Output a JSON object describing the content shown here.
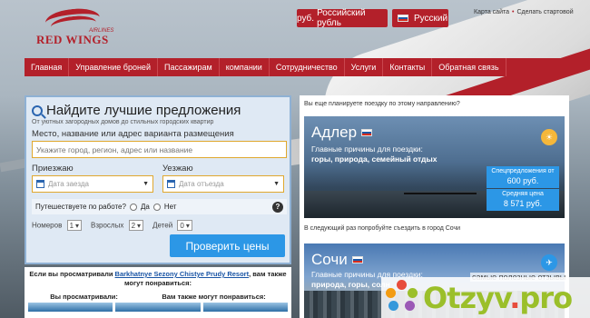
{
  "header": {
    "logo_text": "RED WINGS",
    "logo_sub": "AIRLINES",
    "currency_symbol": "руб.",
    "currency_label": "Российский рубль",
    "language_label": "Русский",
    "links": [
      "Карта сайта",
      "Сделать стартовой"
    ]
  },
  "nav": {
    "items": [
      "Главная",
      "Управление броней",
      "Пассажирам",
      "компании",
      "Сотрудничество",
      "Услуги",
      "Контакты",
      "Обратная связь"
    ]
  },
  "search": {
    "title": "Найдите лучшие предложения",
    "subtitle": "От уютных загородных домов до стильных городских квартир",
    "place_label": "Место, название или адрес варианта размещения",
    "place_placeholder": "Укажите город, регион, адрес или название",
    "checkin_label": "Приезжаю",
    "checkin_placeholder": "Дата заезда",
    "checkout_label": "Уезжаю",
    "checkout_placeholder": "Дата отъезда",
    "work_question": "Путешествуете по работе?",
    "yes": "Да",
    "no": "Нет",
    "help": "?",
    "rooms_label": "Номеров",
    "rooms_value": "1",
    "adults_label": "Взрослых",
    "adults_value": "2",
    "children_label": "Детей",
    "children_value": "0",
    "submit": "Проверить цены"
  },
  "viewed": {
    "prefix": "Если вы просматривали",
    "link": "Barkhatnye Sezony Chistye Prudy Resort",
    "suffix": ", вам также могут понравиться:",
    "col1": "Вы просматривали:",
    "col2": "Вам также могут понравиться:"
  },
  "right": {
    "heading": "Вы еще планируете поездку по этому направлению?",
    "mid_heading": "В следующий раз попробуйте съездить в город Сочи",
    "dest1": {
      "name": "Адлер",
      "reasons_label": "Главные причины для поездки:",
      "reasons": "горы, природа, семейный отдых",
      "deal_label": "Спецпредложения от",
      "deal_price": "600 руб.",
      "avg_label": "Средняя цена",
      "avg_price": "8 571 руб."
    },
    "dest2": {
      "name": "Сочи",
      "reasons_label": "Главные причины для поездки:",
      "reasons": "природа, горы, солн"
    }
  },
  "watermark": {
    "tagline": "самые полезные отзывы",
    "brand_main": "Otzyv",
    "brand_dot": ".",
    "brand_tld": "pro"
  },
  "colors": {
    "brand_red": "#b3202a",
    "accent_blue": "#2c97e6",
    "search_bg": "#dfe9f4"
  }
}
